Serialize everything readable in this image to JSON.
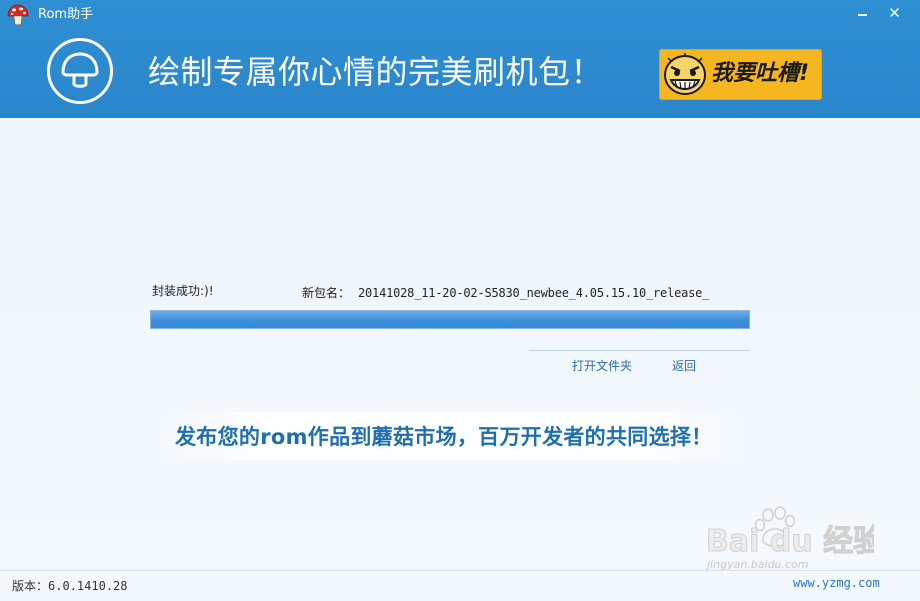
{
  "window": {
    "title": "Rom助手",
    "minimize_label": "",
    "close_label": "✕"
  },
  "banner": {
    "slogan": "绘制专属你心情的完美刷机包！",
    "complain_button_label": "我要吐槽!"
  },
  "result": {
    "status_text": "封装成功:)!",
    "package_name_label": "新包名：",
    "package_name_value": "20141028_11-20-02-S5830_newbee_4.05.15.10_release_",
    "progress_fraction": 1.0
  },
  "actions": {
    "open_folder_label": "打开文件夹",
    "back_label": "返回"
  },
  "promo": {
    "text": "发布您的rom作品到蘑菇市场，百万开发者的共同选择！"
  },
  "status_bar": {
    "version_label": "版本：",
    "version_value": "6.0.1410.28"
  },
  "watermark": {
    "logo_text": "Bai du 经验",
    "site_text": "jingyan.baidu.com",
    "domain_text": "www.yzmg.com"
  },
  "colors": {
    "banner_blue": "#2a86cc",
    "complain_yellow": "#f5b61f",
    "progress_blue": "#3d8fdb",
    "link_blue": "#2a6fb0",
    "promo_blue": "#1f6fae"
  },
  "icons": {
    "app_logo": "red-mushroom-icon",
    "banner_logo": "mushroom-outline-icon",
    "complain_face": "rage-face-icon",
    "minimize": "minimize-icon",
    "close": "close-icon"
  }
}
